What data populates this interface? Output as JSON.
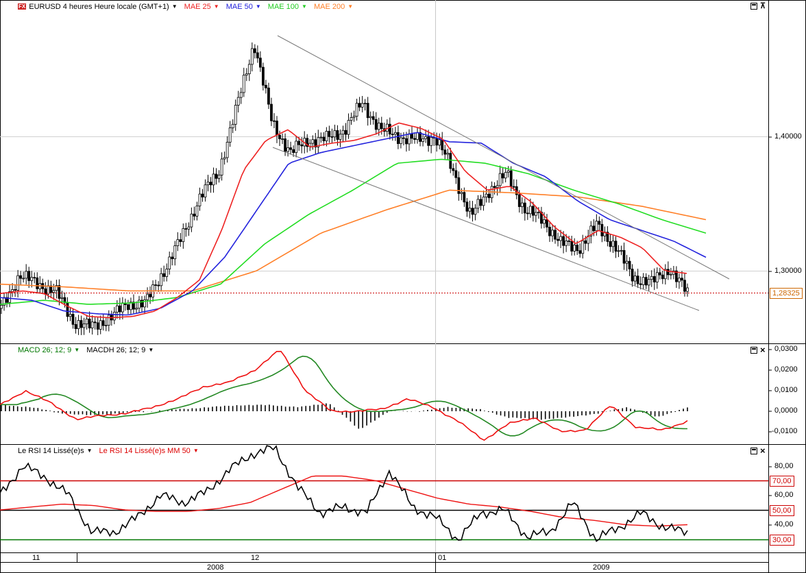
{
  "price_panel": {
    "symbol_tag": "FX",
    "title": "EURUSD 4 heures Heure locale (GMT+1)",
    "indicators": [
      {
        "label": "MAE 25",
        "color": "#ee2222"
      },
      {
        "label": "MAE 50",
        "color": "#2222dd"
      },
      {
        "label": "MAE 100",
        "color": "#22cc22"
      },
      {
        "label": "MAE 200",
        "color": "#ff7f27"
      }
    ],
    "y_ticks": [
      "1,40000",
      "1,30000"
    ],
    "last_price": "1,28325"
  },
  "macd_panel": {
    "labels": [
      {
        "label": "MACD 26; 12; 9",
        "color": "#007700"
      },
      {
        "label": "MACDH 26; 12; 9",
        "color": "#000000"
      }
    ],
    "y_ticks": [
      "0,0300",
      "0,0200",
      "0,0100",
      "0,0000",
      "-0,0100"
    ]
  },
  "rsi_panel": {
    "labels": [
      {
        "label": "Le RSI 14 Lissé(e)s",
        "color": "#000000"
      },
      {
        "label": "Le RSI 14 Lissé(e)s MM 50",
        "color": "#dd0000"
      }
    ],
    "y_ticks": [
      "80,00",
      "60,00",
      "40,00"
    ],
    "levels": [
      {
        "value": "70,00",
        "color": "#cc0000"
      },
      {
        "value": "50,00",
        "color": "#cc0000"
      },
      {
        "value": "30,00",
        "color": "#cc0000"
      }
    ]
  },
  "x_axis": {
    "months": [
      "11",
      "12",
      "01"
    ],
    "years": [
      "2008",
      "2009"
    ]
  },
  "colors": {
    "ma25": "#ee2222",
    "ma50": "#2222dd",
    "ma100": "#22dd22",
    "ma200": "#ff7f27",
    "macd_red": "#ee1111",
    "macd_green": "#228822",
    "rsi_ma": "#ee1111"
  },
  "chart_data": [
    {
      "type": "candlestick",
      "title": "EURUSD 4 heures Heure locale (GMT+1)",
      "ylim": [
        1.23,
        1.5
      ],
      "yticks": [
        1.3,
        1.4
      ],
      "last": 1.28325,
      "series": [
        {
          "name": "EURUSD close",
          "values": [
            1.272,
            1.297,
            1.29,
            1.285,
            1.262,
            1.258,
            1.265,
            1.275,
            1.276,
            1.3,
            1.325,
            1.355,
            1.372,
            1.42,
            1.47,
            1.41,
            1.388,
            1.397,
            1.398,
            1.405,
            1.425,
            1.405,
            1.4,
            1.397,
            1.4,
            1.375,
            1.34,
            1.36,
            1.372,
            1.345,
            1.338,
            1.32,
            1.317,
            1.334,
            1.318,
            1.295,
            1.291,
            1.302,
            1.283
          ]
        },
        {
          "name": "MAE 25",
          "values": [
            1.283,
            1.285,
            1.283,
            1.274,
            1.266,
            1.265,
            1.266,
            1.27,
            1.28,
            1.293,
            1.33,
            1.375,
            1.397,
            1.405,
            1.392,
            1.395,
            1.397,
            1.402,
            1.41,
            1.406,
            1.398,
            1.374,
            1.36,
            1.363,
            1.351,
            1.333,
            1.32,
            1.33,
            1.325,
            1.317,
            1.3,
            1.298
          ]
        },
        {
          "name": "MAE 50",
          "values": [
            1.28,
            1.278,
            1.27,
            1.268,
            1.267,
            1.272,
            1.285,
            1.31,
            1.345,
            1.38,
            1.388,
            1.393,
            1.398,
            1.403,
            1.396,
            1.395,
            1.38,
            1.37,
            1.352,
            1.338,
            1.33,
            1.322,
            1.31
          ]
        },
        {
          "name": "MAE 100",
          "values": [
            1.275,
            1.278,
            1.275,
            1.276,
            1.28,
            1.29,
            1.32,
            1.342,
            1.36,
            1.38,
            1.383,
            1.38,
            1.372,
            1.36,
            1.35,
            1.338,
            1.328
          ]
        },
        {
          "name": "MAE 200",
          "values": [
            1.29,
            1.288,
            1.285,
            1.285,
            1.3,
            1.328,
            1.345,
            1.36,
            1.358,
            1.355,
            1.348,
            1.338
          ]
        }
      ]
    },
    {
      "type": "line",
      "title": "MACD 26; 12; 9",
      "ylim": [
        -0.0145,
        0.031
      ],
      "yticks": [
        0.03,
        0.02,
        0.01,
        0.0,
        -0.01
      ],
      "series": [
        {
          "name": "MACD 26; 12; 9",
          "values": [
            0.003,
            0.01,
            0.004,
            -0.004,
            -0.002,
            -0.001,
            0.002,
            0.006,
            0.012,
            0.014,
            0.02,
            0.03,
            0.01,
            0.0,
            0.0,
            0.001,
            0.006,
            0.002,
            -0.005,
            -0.014,
            -0.006,
            -0.003,
            -0.01,
            -0.009,
            0.003,
            -0.008,
            -0.009,
            -0.005
          ]
        },
        {
          "name": "MACDH 26; 12; 9",
          "values": [
            0.003,
            0.002,
            -0.001,
            -0.002,
            -0.001,
            0.0,
            0.001,
            0.002,
            0.003,
            0.003,
            0.002,
            0.004,
            -0.009,
            0.0,
            0.0,
            0.002,
            0.001,
            -0.003,
            -0.004,
            -0.003,
            -0.001,
            0.002,
            -0.003,
            0.002
          ]
        }
      ]
    },
    {
      "type": "line",
      "title": "Le RSI 14 Lissé(e)s",
      "ylim": [
        18,
        96
      ],
      "yticks": [
        80,
        60,
        40
      ],
      "levels": [
        70,
        50,
        30
      ],
      "series": [
        {
          "name": "Le RSI 14 Lissé(e)s",
          "values": [
            60,
            80,
            72,
            60,
            35,
            35,
            45,
            60,
            55,
            62,
            77,
            88,
            92,
            65,
            48,
            52,
            48,
            77,
            52,
            45,
            30,
            48,
            50,
            32,
            35,
            55,
            30,
            38,
            48,
            38,
            35
          ]
        },
        {
          "name": "Le RSI 14 Lissé(e)s MM 50",
          "values": [
            50,
            52,
            54,
            53,
            50,
            49,
            49,
            51,
            55,
            64,
            73,
            73,
            70,
            64,
            58,
            54,
            52,
            49,
            45,
            43,
            40,
            39,
            40
          ]
        }
      ]
    }
  ]
}
